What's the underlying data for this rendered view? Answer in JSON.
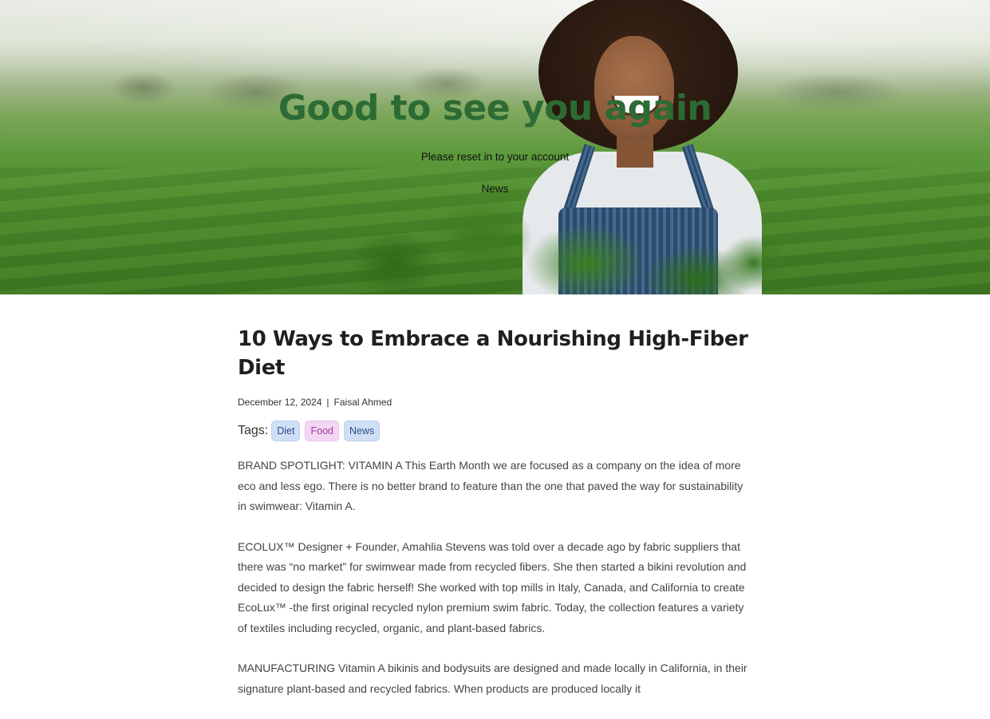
{
  "hero": {
    "title": "Good to see you again",
    "subtitle": "Please reset in to your account",
    "category": "News"
  },
  "article": {
    "title": "10 Ways to Embrace a Nourishing High-Fiber Diet",
    "date": "December 12, 2024",
    "separator": "|",
    "author": "Faisal Ahmed",
    "tags_label": "Tags:",
    "tags": [
      "Diet",
      "Food",
      "News"
    ],
    "paragraphs": [
      "BRAND SPOTLIGHT: VITAMIN A This Earth Month we are focused as a company on the idea of more eco and less ego. There is no better brand to feature than the one that paved the way for sustainability in swimwear: Vitamin A.",
      "ECOLUX™ Designer + Founder, Amahlia Stevens was told over a decade ago by fabric suppliers that there was “no market” for swimwear made from recycled fibers. She then started a bikini revolution and decided to design the fabric herself! She worked with top mills in Italy, Canada, and California to create EcoLux™ -the first original recycled nylon premium swim fabric. Today, the collection features a variety of textiles including recycled, organic, and plant-based fabrics.",
      "MANUFACTURING Vitamin A bikinis and bodysuits are designed and made locally in California, in their signature plant-based and recycled fabrics. When products are produced locally it"
    ]
  },
  "colors": {
    "hero_title": "#2c6b33",
    "tag_diet_bg": "#cfdff5",
    "tag_food_bg": "#f3d6f2",
    "tag_news_bg": "#cfdff5"
  }
}
